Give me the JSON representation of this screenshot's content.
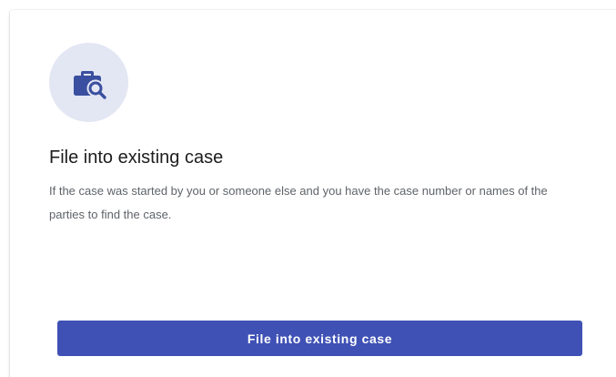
{
  "card": {
    "icon": "briefcase-search-icon",
    "title": "File into existing case",
    "description": "If the case was started by you or someone else and you have the case number or names of the parties to find the case.",
    "button_label": "File into existing case"
  },
  "colors": {
    "accent": "#3f51b5",
    "icon_circle": "#e3e6f3",
    "icon_fill": "#3a4f9f",
    "title_text": "#1d1d1f",
    "body_text": "#5f6368"
  }
}
